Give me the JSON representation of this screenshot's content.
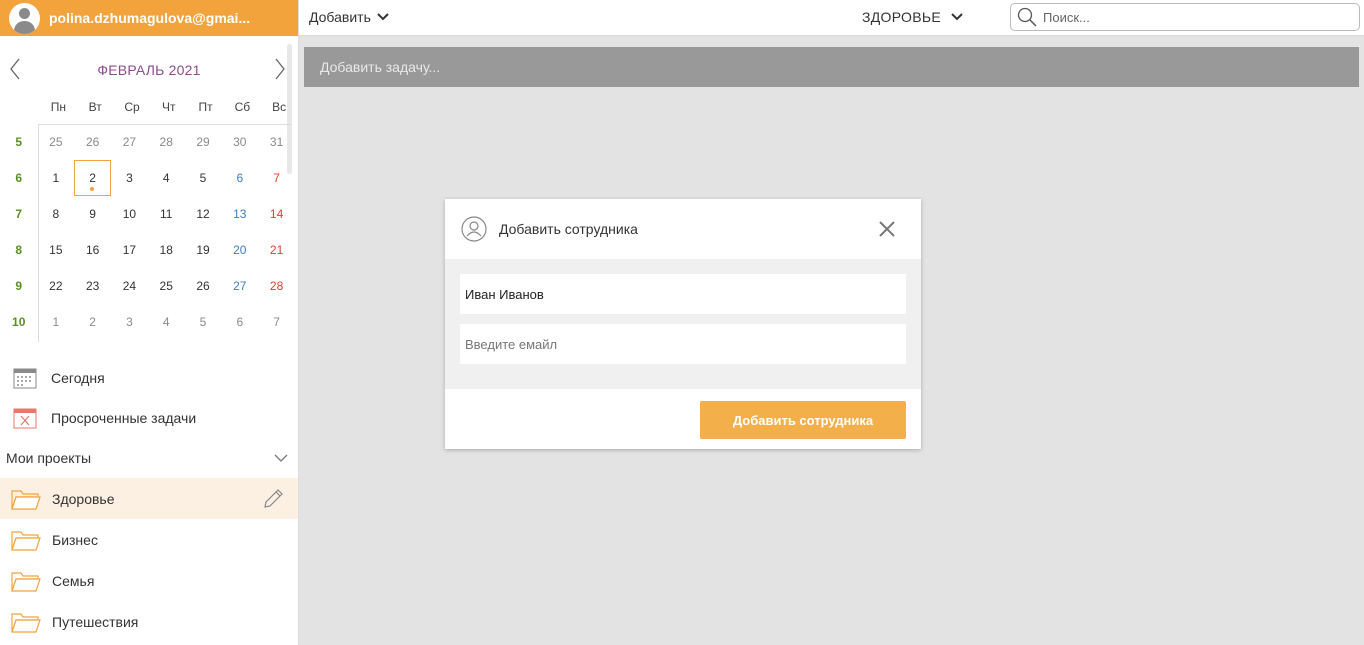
{
  "user": {
    "email": "polina.dzhumagulova@gmai..."
  },
  "calendar": {
    "title": "ФЕВРАЛЬ 2021",
    "dow": [
      "Пн",
      "Вт",
      "Ср",
      "Чт",
      "Пт",
      "Сб",
      "Вс"
    ],
    "weeks": [
      {
        "num": "5",
        "days": [
          "25",
          "26",
          "27",
          "28",
          "29",
          "30",
          "31"
        ]
      },
      {
        "num": "6",
        "days": [
          "1",
          "2",
          "3",
          "4",
          "5",
          "6",
          "7"
        ]
      },
      {
        "num": "7",
        "days": [
          "8",
          "9",
          "10",
          "11",
          "12",
          "13",
          "14"
        ]
      },
      {
        "num": "8",
        "days": [
          "15",
          "16",
          "17",
          "18",
          "19",
          "20",
          "21"
        ]
      },
      {
        "num": "9",
        "days": [
          "22",
          "23",
          "24",
          "25",
          "26",
          "27",
          "28"
        ]
      },
      {
        "num": "10",
        "days": [
          "1",
          "2",
          "3",
          "4",
          "5",
          "6",
          "7"
        ]
      }
    ]
  },
  "nav": {
    "today": "Сегодня",
    "overdue": "Просроченные задачи"
  },
  "projects": {
    "heading": "Мои проекты",
    "items": [
      "Здоровье",
      "Бизнес",
      "Семья",
      "Путешествия"
    ]
  },
  "topbar": {
    "add_label": "Добавить",
    "project_label": "ЗДОРОВЬЕ",
    "search_placeholder": "Поиск..."
  },
  "main": {
    "add_task_placeholder": "Добавить задачу..."
  },
  "modal": {
    "title": "Добавить сотрудника",
    "name_value": "Иван Иванов",
    "email_placeholder": "Введите емайл",
    "submit_label": "Добавить сотрудника"
  },
  "colors": {
    "accent": "#f3a33b",
    "button": "#f3b04a",
    "week_num": "#5b8f22",
    "saturday": "#3d7fc7",
    "sunday": "#e0402e",
    "month_title": "#8b4d8e"
  }
}
